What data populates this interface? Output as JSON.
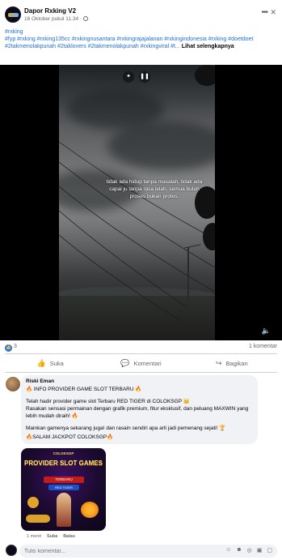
{
  "post": {
    "page_name": "Dapor Rxking V2",
    "time": "16 Oktober pukul 11.34 ·",
    "caption_hashtags": "#rxking\n#fyp #rxking #rxking135cc #rxkingnusantara #rxkingrajajalanan #rxkingindonesia #rxking #doetdoet #2takmenolakpunah #2taklovers #2takmenolakpunah #rxkingviral #t...",
    "see_more": "Lihat selengkapnya"
  },
  "video": {
    "overlay_text": "tidak ada hidup tanpa masalah, tidak ada capai ju tanpa rasa lelah, semua butuh proses bukan protes."
  },
  "reactions": {
    "like_count": "3",
    "comment_count": "1 komentar"
  },
  "actions": {
    "like": "Suka",
    "comment": "Komentari",
    "share": "Bagikan"
  },
  "comment": {
    "author": "Riski Eman",
    "line1": "🔥 INFO PROVIDER GAME SLOT TERBARU 🔥",
    "line2": "Telah hadir provider game slot Terbaru RED TIGER di COLOKSGP 👑",
    "line3": "Rasakan sensasi permainan dengan grafik premium, fitur eksklusif, dan peluang MAXWIN yang lebih mudah diraih! 🔥",
    "line4": "Mainkan gamenya sekarang juga! dan rasain sendiri apa arti jadi pemenang sejati! 🏆",
    "line5": "🔥SALAM JACKPOT COLOKSGP🔥",
    "time": "1 menit",
    "like": "Suka",
    "reply": "Balas"
  },
  "banner": {
    "brand": "COLOKSGP",
    "title": "PROVIDER SLOT GAMES",
    "tag1": "TERBARU",
    "tag2": "RED TIGER"
  },
  "input": {
    "placeholder": "Tulis komentar..."
  }
}
